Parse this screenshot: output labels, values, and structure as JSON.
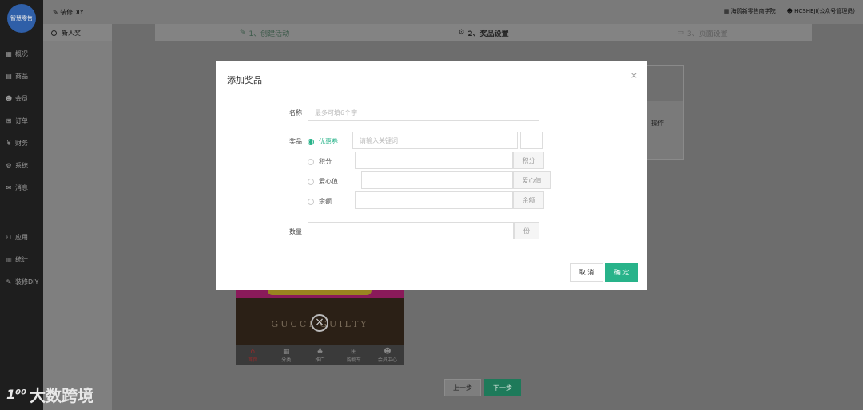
{
  "sidebar": {
    "logo_text": "智慧零售",
    "items": [
      {
        "icon": "chart-icon",
        "glyph": "▦",
        "label": "概况"
      },
      {
        "icon": "goods-icon",
        "glyph": "▤",
        "label": "商品"
      },
      {
        "icon": "users-icon",
        "glyph": "☻",
        "label": "会员"
      },
      {
        "icon": "cart-icon",
        "glyph": "⊞",
        "label": "订单"
      },
      {
        "icon": "yen-icon",
        "glyph": "¥",
        "label": "财务"
      },
      {
        "icon": "gear-icon",
        "glyph": "⚙",
        "label": "系统"
      },
      {
        "icon": "chat-icon",
        "glyph": "✉",
        "label": "消息"
      }
    ],
    "items_bottom": [
      {
        "icon": "apps-icon",
        "glyph": "⚇",
        "label": "应用"
      },
      {
        "icon": "stats-icon",
        "glyph": "▥",
        "label": "统计"
      },
      {
        "icon": "decorate-icon",
        "glyph": "✎",
        "label": "装修DIY"
      }
    ]
  },
  "topbar": {
    "title": "装修DIY",
    "school": "海鸥新零售商学院",
    "account": "HCSHEJI(公众号管理员)"
  },
  "subnav": {
    "item": "新人奖"
  },
  "steps": [
    {
      "label": "1、创建活动",
      "glyph": "✎"
    },
    {
      "label": "2、奖品设置",
      "glyph": "⚙"
    },
    {
      "label": "3、页面设置",
      "glyph": "▭"
    }
  ],
  "table": {
    "op_header": "操作"
  },
  "phone": {
    "brand": "GUCCI GUILTY",
    "tabs": [
      "首页",
      "分类",
      "推广",
      "购物车",
      "会员中心"
    ]
  },
  "footer": {
    "prev": "上一步",
    "next": "下一步"
  },
  "watermark": {
    "logo": "1⁰⁰",
    "text": "大数跨境"
  },
  "modal": {
    "title": "添加奖品",
    "name_label": "名称",
    "name_placeholder": "最多可填6个字",
    "prize_label": "奖品",
    "options": [
      {
        "label": "优惠券",
        "selected": true
      },
      {
        "label": "积分",
        "selected": false
      },
      {
        "label": "爱心值",
        "selected": false
      },
      {
        "label": "余额",
        "selected": false
      }
    ],
    "coupon_placeholder": "请输入关键词",
    "points_suffix": "积分",
    "love_suffix": "爱心值",
    "balance_suffix": "余额",
    "qty_label": "数量",
    "qty_suffix": "份",
    "cancel": "取 消",
    "confirm": "确 定"
  }
}
